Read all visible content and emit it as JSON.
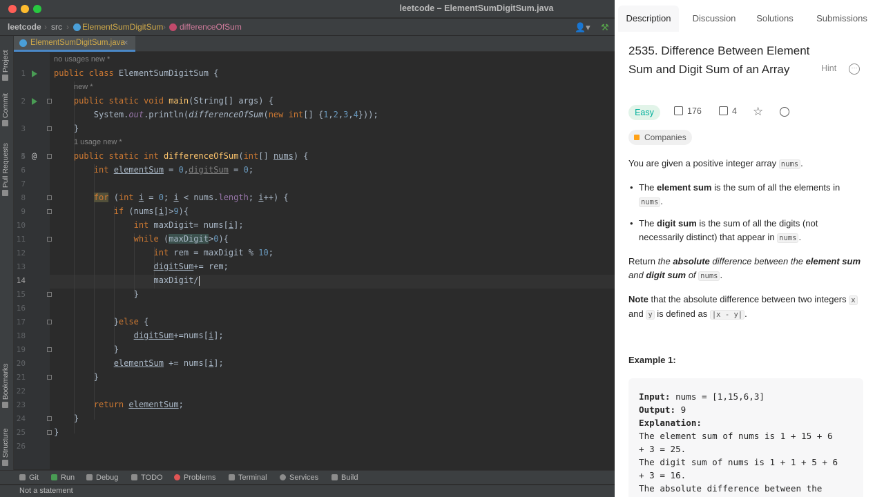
{
  "window": {
    "title": "leetcode – ElementSumDigitSum.java",
    "traffic_lights": {
      "close": "#ff5f57",
      "minimize": "#febc2e",
      "maximize": "#28c840"
    }
  },
  "navbar": {
    "project": "leetcode",
    "folder": "src",
    "class": "ElementSumDigitSum",
    "method": "differenceOfSum"
  },
  "tabs": [
    {
      "label": "ElementSumDigitSum.java"
    }
  ],
  "side_tools": {
    "project": "Project",
    "commit": "Commit",
    "pull_requests": "Pull Requests",
    "bookmarks": "Bookmarks",
    "structure": "Structure"
  },
  "editor": {
    "line_numbers": [
      "1",
      "2",
      "3",
      "4",
      "5",
      "6",
      "7",
      "8",
      "9",
      "10",
      "11",
      "12",
      "13",
      "14",
      "15",
      "16",
      "17",
      "18",
      "19",
      "20",
      "21",
      "22",
      "23",
      "24",
      "25",
      "26"
    ],
    "current_line": "14",
    "hints": {
      "h1": "no usages   new *",
      "h2": "new *",
      "h3": "1 usage   new *"
    }
  },
  "bottom_tools": [
    {
      "label": "Git"
    },
    {
      "label": "Run"
    },
    {
      "label": "Debug"
    },
    {
      "label": "TODO"
    },
    {
      "label": "Problems"
    },
    {
      "label": "Terminal"
    },
    {
      "label": "Services"
    },
    {
      "label": "Build"
    }
  ],
  "status": "Not a statement",
  "leetcode": {
    "tabs": [
      "Description",
      "Discussion",
      "Solutions",
      "Submissions"
    ],
    "title": "2535. Difference Between Element Sum and Digit Sum of an Array",
    "hint": "Hint",
    "difficulty": "Easy",
    "likes": "176",
    "dislikes": "4",
    "companies": "Companies",
    "intro_a": "You are given a positive integer array ",
    "nums": "nums",
    "bullet1_a": "The ",
    "bullet1_b": "element sum",
    "bullet1_c": " is the sum of all the elements in ",
    "bullet2_a": "The ",
    "bullet2_b": "digit sum",
    "bullet2_c": " is the sum of all the digits (not necessarily distinct) that appear in ",
    "return_a": "Return ",
    "return_b": "the ",
    "return_c": "absolute",
    "return_d": " difference between the ",
    "return_e": "element sum",
    "return_f": " and ",
    "return_g": "digit sum",
    "return_h": " of ",
    "note_a": "Note",
    "note_b": " that the absolute difference between two integers ",
    "note_x": "x",
    "note_and": " and ",
    "note_y": "y",
    "note_c": " is defined as ",
    "note_abs": "|x - y|",
    "example_title": "Example 1:",
    "example": {
      "input_label": "Input:",
      "input_value": " nums = [1,15,6,3]",
      "output_label": "Output:",
      "output_value": " 9",
      "explanation_label": "Explanation:",
      "exp1": "The element sum of nums is 1 + 15 + 6",
      "exp2": "+ 3 = 25.",
      "exp3": "The digit sum of nums is 1 + 1 + 5 + 6",
      "exp4": "+ 3 = 16.",
      "exp5": "The absolute difference between the"
    }
  }
}
